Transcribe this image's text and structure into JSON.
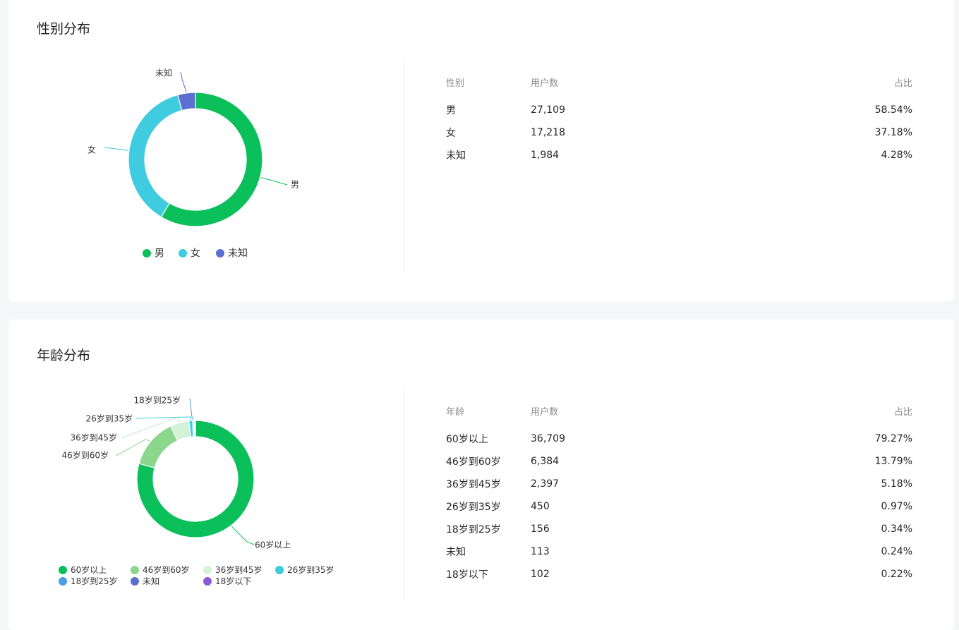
{
  "gender": {
    "title": "性别分布",
    "table": {
      "headers": [
        "性别",
        "用户数",
        "占比"
      ],
      "rows": [
        [
          "男",
          "27,109",
          "58.54%"
        ],
        [
          "女",
          "17,218",
          "37.18%"
        ],
        [
          "未知",
          "1,984",
          "4.28%"
        ]
      ]
    },
    "chart_data": {
      "type": "pie",
      "donut": true,
      "categories": [
        "男",
        "女",
        "未知"
      ],
      "values": [
        27109,
        17218,
        1984
      ],
      "percentages": [
        58.54,
        37.18,
        4.28
      ],
      "colors": [
        "#0bbf5a",
        "#3fcce0",
        "#5b6fd1"
      ],
      "legend_position": "bottom",
      "slice_labels": [
        "男",
        "女",
        "未知"
      ]
    }
  },
  "age": {
    "title": "年龄分布",
    "table": {
      "headers": [
        "年龄",
        "用户数",
        "占比"
      ],
      "rows": [
        [
          "60岁以上",
          "36,709",
          "79.27%"
        ],
        [
          "46岁到60岁",
          "6,384",
          "13.79%"
        ],
        [
          "36岁到45岁",
          "2,397",
          "5.18%"
        ],
        [
          "26岁到35岁",
          "450",
          "0.97%"
        ],
        [
          "18岁到25岁",
          "156",
          "0.34%"
        ],
        [
          "未知",
          "113",
          "0.24%"
        ],
        [
          "18岁以下",
          "102",
          "0.22%"
        ]
      ]
    },
    "chart_data": {
      "type": "pie",
      "donut": true,
      "categories": [
        "60岁以上",
        "46岁到60岁",
        "36岁到45岁",
        "26岁到35岁",
        "18岁到25岁",
        "未知",
        "18岁以下"
      ],
      "values": [
        36709,
        6384,
        2397,
        450,
        156,
        113,
        102
      ],
      "percentages": [
        79.27,
        13.79,
        5.18,
        0.97,
        0.34,
        0.24,
        0.22
      ],
      "colors": [
        "#0bbf5a",
        "#8cd68e",
        "#d3f2d6",
        "#3fcce0",
        "#4a9ee8",
        "#5b6fd1",
        "#8a5bd4"
      ],
      "legend_position": "bottom",
      "slice_labels": [
        "60岁以上",
        "46岁到60岁",
        "36岁到45岁",
        "26岁到35岁",
        "18岁到25岁"
      ]
    }
  }
}
